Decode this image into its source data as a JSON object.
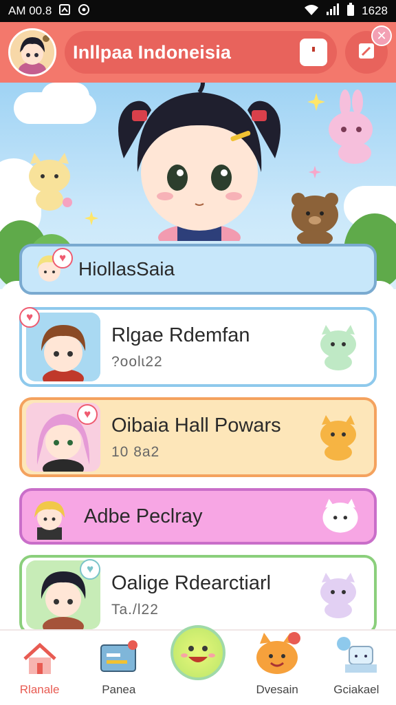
{
  "status_bar": {
    "left_text": "AM 00.8",
    "right_text": "1628",
    "left_icons": [
      "screenshot-icon",
      "settings-icon"
    ],
    "right_icons": [
      "wifi-icon",
      "signal-icon",
      "battery-icon"
    ]
  },
  "header": {
    "title": "Inllpaa Indoneisia",
    "actions": [
      "bookmark-icon",
      "edit-icon"
    ],
    "close_glyph": "✕"
  },
  "banner": {
    "character": "black-haired-chibi-girl",
    "decorations": [
      "cloud",
      "star",
      "bunny",
      "cat",
      "bear"
    ]
  },
  "search_card": {
    "label": "HiollasSaia"
  },
  "list": [
    {
      "title": "Rlgae Rdemfan",
      "subtitle": "?oolɩ22",
      "theme": "blue",
      "heart": "♥"
    },
    {
      "title": "Oibaia Hall Powars",
      "subtitle": "10 8a2",
      "theme": "orange",
      "heart": "♥"
    },
    {
      "title": "Adbe Peclray",
      "subtitle": "",
      "theme": "pink"
    },
    {
      "title": "Oalige Rdearctiarl",
      "subtitle": "Ta./l22",
      "theme": "green",
      "heart": "♥"
    }
  ],
  "bottom_nav": [
    {
      "label": "Rlanale",
      "icon": "home-icon",
      "active": true
    },
    {
      "label": "Panea",
      "icon": "cards-icon",
      "active": false
    },
    {
      "label": "",
      "icon": "smile-fab-icon",
      "active": false
    },
    {
      "label": "Dvesain",
      "icon": "pet-icon",
      "active": false
    },
    {
      "label": "Gciakael",
      "icon": "gift-icon",
      "active": false
    }
  ],
  "colors": {
    "header": "#f3786c",
    "header_pill": "#e8635c",
    "blue_card": "#8ec9ec",
    "orange_card": "#f4a25e",
    "pink_card": "#c96ec9",
    "green_card": "#8bcf7c"
  }
}
